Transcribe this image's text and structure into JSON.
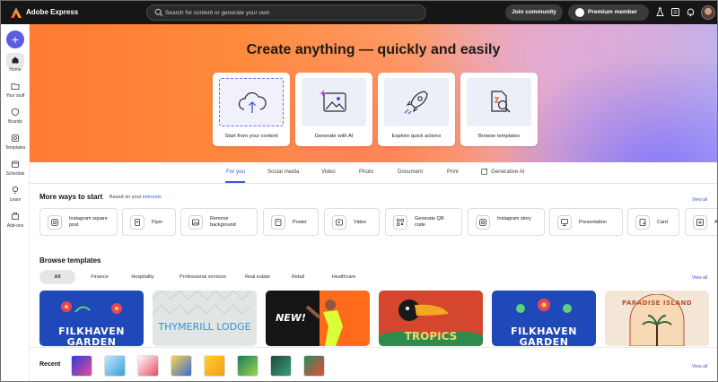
{
  "topbar": {
    "app_name": "Adobe Express",
    "search_placeholder": "Search for content or generate your own",
    "join_label": "Join community",
    "premium_label": "Premium member"
  },
  "sidebar": {
    "create_glyph": "+",
    "items": [
      {
        "label": "Home",
        "icon": "home-icon"
      },
      {
        "label": "Your stuff",
        "icon": "folder-icon"
      },
      {
        "label": "Brands",
        "icon": "brand-icon"
      },
      {
        "label": "Templates",
        "icon": "templates-icon"
      },
      {
        "label": "Schedule",
        "icon": "calendar-icon"
      },
      {
        "label": "Learn",
        "icon": "lightbulb-icon"
      },
      {
        "label": "Add-ons",
        "icon": "addons-icon"
      }
    ]
  },
  "hero": {
    "title": "Create anything — quickly and easily",
    "cards": [
      {
        "label": "Start from your content",
        "icon": "upload-cloud-icon"
      },
      {
        "label": "Generate with AI",
        "icon": "ai-image-icon"
      },
      {
        "label": "Explore quick actions",
        "icon": "rocket-icon"
      },
      {
        "label": "Browse templates",
        "icon": "template-search-icon"
      }
    ]
  },
  "tabs": [
    "For you",
    "Social media",
    "Video",
    "Photo",
    "Document",
    "Print",
    "Generative AI"
  ],
  "more_ways": {
    "title": "More ways to start",
    "subtitle_prefix": "Based on your",
    "subtitle_link": "interests",
    "view_all": "View all",
    "items": [
      {
        "label": "Instagram square post",
        "icon": "instagram-icon"
      },
      {
        "label": "Flyer",
        "icon": "flyer-icon"
      },
      {
        "label": "Remove background",
        "icon": "remove-bg-icon"
      },
      {
        "label": "Poster",
        "icon": "poster-icon"
      },
      {
        "label": "Video",
        "icon": "video-icon"
      },
      {
        "label": "Generate QR code",
        "icon": "qr-code-icon"
      },
      {
        "label": "Instagram story",
        "icon": "instagram-icon"
      },
      {
        "label": "Presentation",
        "icon": "presentation-icon"
      },
      {
        "label": "Card",
        "icon": "card-icon"
      },
      {
        "label": "A",
        "icon": "add-icon"
      }
    ]
  },
  "browse": {
    "title": "Browse templates",
    "view_all": "View all",
    "filters": [
      "All",
      "Finance",
      "Hospitality",
      "Professional services",
      "Real estate",
      "Retail",
      "Healthcare"
    ],
    "templates": [
      {
        "text": "FILKHAVEN GARDEN",
        "bg": "#1f48b8",
        "fg": "#ffffff"
      },
      {
        "text": "THYMERILL LODGE",
        "bg": "#dfe6e4",
        "fg": "#3e8fd0"
      },
      {
        "text": "NEW!",
        "bg": "#ff6b1a",
        "fg": "#ffffff"
      },
      {
        "text": "TROPICS",
        "bg": "#d4462e",
        "fg": "#f5d36a"
      },
      {
        "text": "FILKHAVEN GARDEN",
        "bg": "#1f48b8",
        "fg": "#ffffff"
      },
      {
        "text": "PARADISE ISLAND",
        "bg": "#f3e6d6",
        "fg": "#b7522e"
      }
    ]
  },
  "recent": {
    "label": "Recent",
    "view_all": "View all"
  },
  "colors": {
    "accent": "#3b57d8",
    "create": "#5c5ce0",
    "topbar": "#161616"
  }
}
